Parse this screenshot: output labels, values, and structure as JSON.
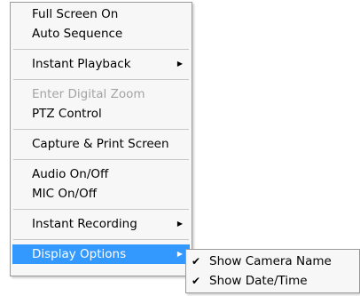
{
  "menu": {
    "items": [
      {
        "label": "Full Screen On"
      },
      {
        "label": "Auto Sequence"
      },
      {
        "label": "Instant Playback"
      },
      {
        "label": "Enter Digital Zoom"
      },
      {
        "label": "PTZ Control"
      },
      {
        "label": "Capture & Print Screen"
      },
      {
        "label": "Audio On/Off"
      },
      {
        "label": "MIC On/Off"
      },
      {
        "label": "Instant Recording"
      },
      {
        "label": "Display Options"
      }
    ]
  },
  "submenu": {
    "items": [
      {
        "label": "Show Camera Name"
      },
      {
        "label": "Show Date/Time"
      }
    ]
  },
  "icons": {
    "submenu_arrow": "triangle-right-icon",
    "check": "checkmark-icon"
  },
  "colors": {
    "highlight": "#3399ff",
    "disabled_text": "#a3a3a3"
  }
}
